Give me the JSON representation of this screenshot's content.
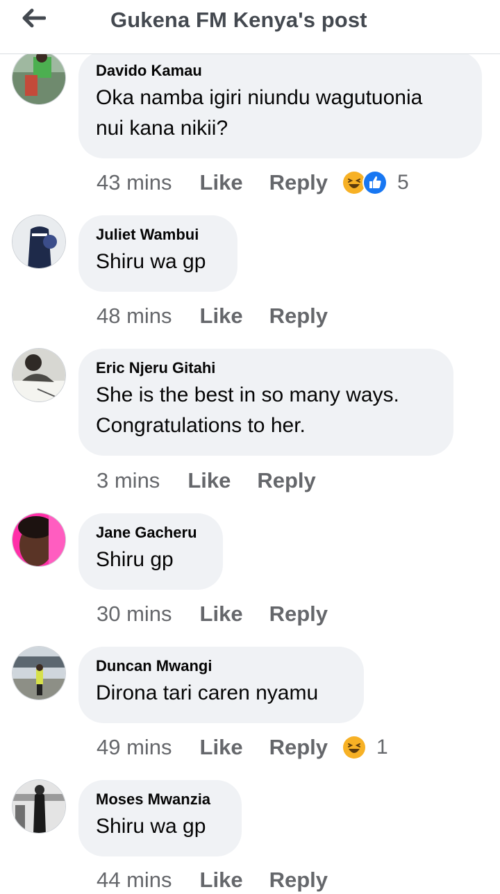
{
  "header": {
    "title": "Gukena FM Kenya's post",
    "back_icon": "back-arrow-icon"
  },
  "colors": {
    "bubble": "#f0f2f5",
    "secondary_text": "#65676b",
    "like_blue": "#1877f2",
    "haha_yellow": "#f7b125"
  },
  "comments": [
    {
      "author": "Davido Kamau",
      "lines": [
        "Oka namba igiri niundu wagutuonia",
        "nui kana nikii?"
      ],
      "time": "43 mins",
      "like": "Like",
      "reply": "Reply",
      "reactions": [
        "haha-reaction-icon",
        "like-reaction-icon"
      ],
      "reaction_count": "5"
    },
    {
      "author": "Juliet Wambui",
      "lines": [
        "Shiru wa gp"
      ],
      "time": "48 mins",
      "like": "Like",
      "reply": "Reply"
    },
    {
      "author": "Eric Njeru Gitahi",
      "lines": [
        "She is the best in so many ways.",
        "Congratulations to her."
      ],
      "time": "3 mins",
      "like": "Like",
      "reply": "Reply"
    },
    {
      "author": "Jane Gacheru",
      "lines": [
        "Shiru gp"
      ],
      "time": "30 mins",
      "like": "Like",
      "reply": "Reply"
    },
    {
      "author": "Duncan Mwangi",
      "lines": [
        "Dirona tari caren nyamu"
      ],
      "time": "49 mins",
      "like": "Like",
      "reply": "Reply",
      "reactions": [
        "haha-reaction-icon"
      ],
      "reaction_count": "1"
    },
    {
      "author": "Moses Mwanzia",
      "lines": [
        "Shiru wa gp"
      ],
      "time": "44 mins",
      "like": "Like",
      "reply": "Reply"
    }
  ]
}
